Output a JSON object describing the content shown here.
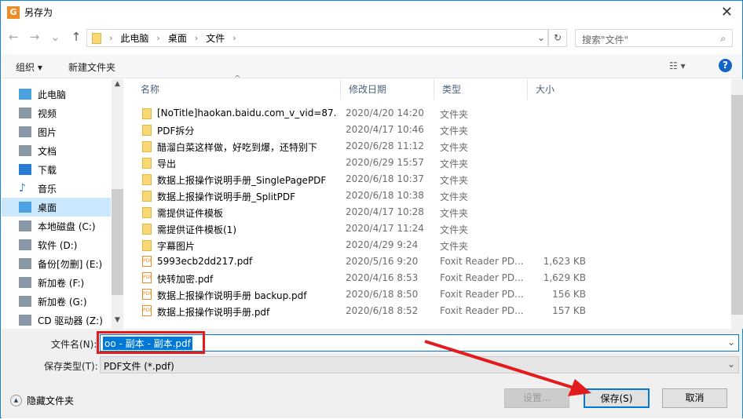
{
  "window": {
    "title": "另存为",
    "close": "✕"
  },
  "nav": {
    "back": "←",
    "forward": "→",
    "recent": "⌄",
    "up": "↑",
    "breadcrumb": [
      "此电脑",
      "桌面",
      "文件"
    ],
    "search_placeholder": "搜索\"文件\""
  },
  "toolbar": {
    "organize": "组织 ▾",
    "new_folder": "新建文件夹",
    "help": "?"
  },
  "sidebar": {
    "items": [
      {
        "label": "此电脑",
        "icon": "computer-icon"
      },
      {
        "label": "视频",
        "icon": "video-icon"
      },
      {
        "label": "图片",
        "icon": "picture-icon"
      },
      {
        "label": "文档",
        "icon": "document-icon"
      },
      {
        "label": "下载",
        "icon": "download-icon"
      },
      {
        "label": "音乐",
        "icon": "music-icon"
      },
      {
        "label": "桌面",
        "icon": "desktop-icon"
      },
      {
        "label": "本地磁盘 (C:)",
        "icon": "drive-icon"
      },
      {
        "label": "软件 (D:)",
        "icon": "drive-icon"
      },
      {
        "label": "备份[勿删] (E:)",
        "icon": "drive-icon"
      },
      {
        "label": "新加卷 (F:)",
        "icon": "drive-icon"
      },
      {
        "label": "新加卷 (G:)",
        "icon": "drive-icon"
      },
      {
        "label": "CD 驱动器 (Z:)",
        "icon": "cd-drive-icon"
      }
    ],
    "selected": "桌面"
  },
  "columns": [
    "名称",
    "修改日期",
    "类型",
    "大小"
  ],
  "files": [
    {
      "name": "[NoTitle]haokan.baidu.com_v_vid=87...",
      "date": "2020/4/20 14:20",
      "type": "文件夹",
      "size": "",
      "kind": "folder"
    },
    {
      "name": "PDF拆分",
      "date": "2020/4/17 10:46",
      "type": "文件夹",
      "size": "",
      "kind": "folder"
    },
    {
      "name": "醋溜白菜这样做，好吃到爆，还特别下",
      "date": "2020/6/28 11:12",
      "type": "文件夹",
      "size": "",
      "kind": "folder"
    },
    {
      "name": "导出",
      "date": "2020/6/29 15:57",
      "type": "文件夹",
      "size": "",
      "kind": "folder"
    },
    {
      "name": "数据上报操作说明手册_SinglePagePDF",
      "date": "2020/6/18 10:37",
      "type": "文件夹",
      "size": "",
      "kind": "folder"
    },
    {
      "name": "数据上报操作说明手册_SplitPDF",
      "date": "2020/6/18 10:38",
      "type": "文件夹",
      "size": "",
      "kind": "folder"
    },
    {
      "name": "需提供证件模板",
      "date": "2020/4/17 10:28",
      "type": "文件夹",
      "size": "",
      "kind": "folder"
    },
    {
      "name": "需提供证件模板(1)",
      "date": "2020/4/17 11:24",
      "type": "文件夹",
      "size": "",
      "kind": "folder"
    },
    {
      "name": "字幕图片",
      "date": "2020/4/29 9:24",
      "type": "文件夹",
      "size": "",
      "kind": "folder"
    },
    {
      "name": "5993ecb2dd217.pdf",
      "date": "2020/5/16 9:20",
      "type": "Foxit Reader PD...",
      "size": "1,623 KB",
      "kind": "pdf"
    },
    {
      "name": "快转加密.pdf",
      "date": "2020/4/16 8:53",
      "type": "Foxit Reader PD...",
      "size": "1,629 KB",
      "kind": "pdf"
    },
    {
      "name": "数据上报操作说明手册 backup.pdf",
      "date": "2020/6/18 8:50",
      "type": "Foxit Reader PD...",
      "size": "156 KB",
      "kind": "pdf"
    },
    {
      "name": "数据上报操作说明手册.pdf",
      "date": "2020/6/18 8:52",
      "type": "Foxit Reader PD...",
      "size": "157 KB",
      "kind": "pdf"
    }
  ],
  "form": {
    "filename_label": "文件名(N):",
    "filename": "oo - 副本 - 副本.pdf",
    "type_label": "保存类型(T):",
    "type": "PDF文件 (*.pdf)"
  },
  "buttons": {
    "hide_folders": "隐藏文件夹",
    "settings": "设置...",
    "save": "保存(S)",
    "cancel": "取消"
  },
  "colors": {
    "accent": "#0078d7",
    "annotation": "#e21c1c"
  }
}
